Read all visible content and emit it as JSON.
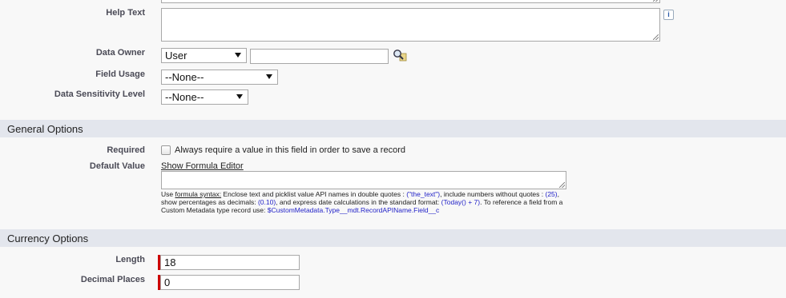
{
  "help_text": {
    "label": "Help Text",
    "info_icon_glyph": "i"
  },
  "data_owner": {
    "label": "Data Owner",
    "select_value": "User",
    "input_value": ""
  },
  "field_usage": {
    "label": "Field Usage",
    "select_value": "--None--"
  },
  "data_sensitivity": {
    "label": "Data Sensitivity Level",
    "select_value": "--None--"
  },
  "general_options": {
    "title": "General Options",
    "required_label": "Required",
    "required_checkbox_text": "Always require a value in this field in order to save a record",
    "default_value_label": "Default Value",
    "formula_editor_link": "Show Formula Editor",
    "help": {
      "use": "Use ",
      "formula_syntax": "formula syntax:",
      "part1": " Enclose text and picklist value API names in double quotes : ",
      "code1": "(\"the_text\")",
      "part2": ", include numbers without quotes : ",
      "code2": "(25)",
      "part3": ", show percentages as decimals: ",
      "code3": "(0.10)",
      "part4": ", and express date calculations in the standard format: ",
      "code4": "(Today() + 7)",
      "part5": ". To reference a field from a Custom Metadata type record use: ",
      "code5": "$CustomMetadata.Type__mdt.RecordAPIName.Field__c"
    }
  },
  "currency_options": {
    "title": "Currency Options",
    "length_label": "Length",
    "length_value": "18",
    "decimal_label": "Decimal Places",
    "decimal_value": "0"
  },
  "colors": {
    "section_bg": "#e3e6ed",
    "required": "#cc0000",
    "link_code": "#2323c8"
  }
}
